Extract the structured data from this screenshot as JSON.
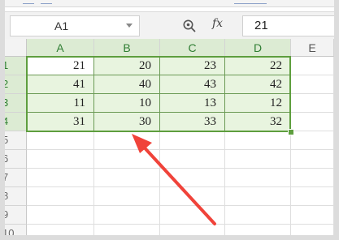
{
  "name_box": {
    "value": "A1"
  },
  "formula_bar": {
    "fx_label": "fx",
    "value": "21"
  },
  "columns": [
    "A",
    "B",
    "C",
    "D",
    "E"
  ],
  "rows": [
    "1",
    "2",
    "3",
    "4",
    "5",
    "6",
    "7",
    "8",
    "9",
    "10"
  ],
  "cells": [
    [
      "21",
      "20",
      "23",
      "22"
    ],
    [
      "41",
      "40",
      "43",
      "42"
    ],
    [
      "11",
      "10",
      "13",
      "12"
    ],
    [
      "31",
      "30",
      "33",
      "32"
    ]
  ],
  "colors": {
    "selection": "#5e9e3e",
    "selected_fill": "#e8f4df",
    "annotation_arrow": "#f0433a"
  },
  "icons": [
    "zoom-icon",
    "fx-icon",
    "chevron-down-icon"
  ]
}
